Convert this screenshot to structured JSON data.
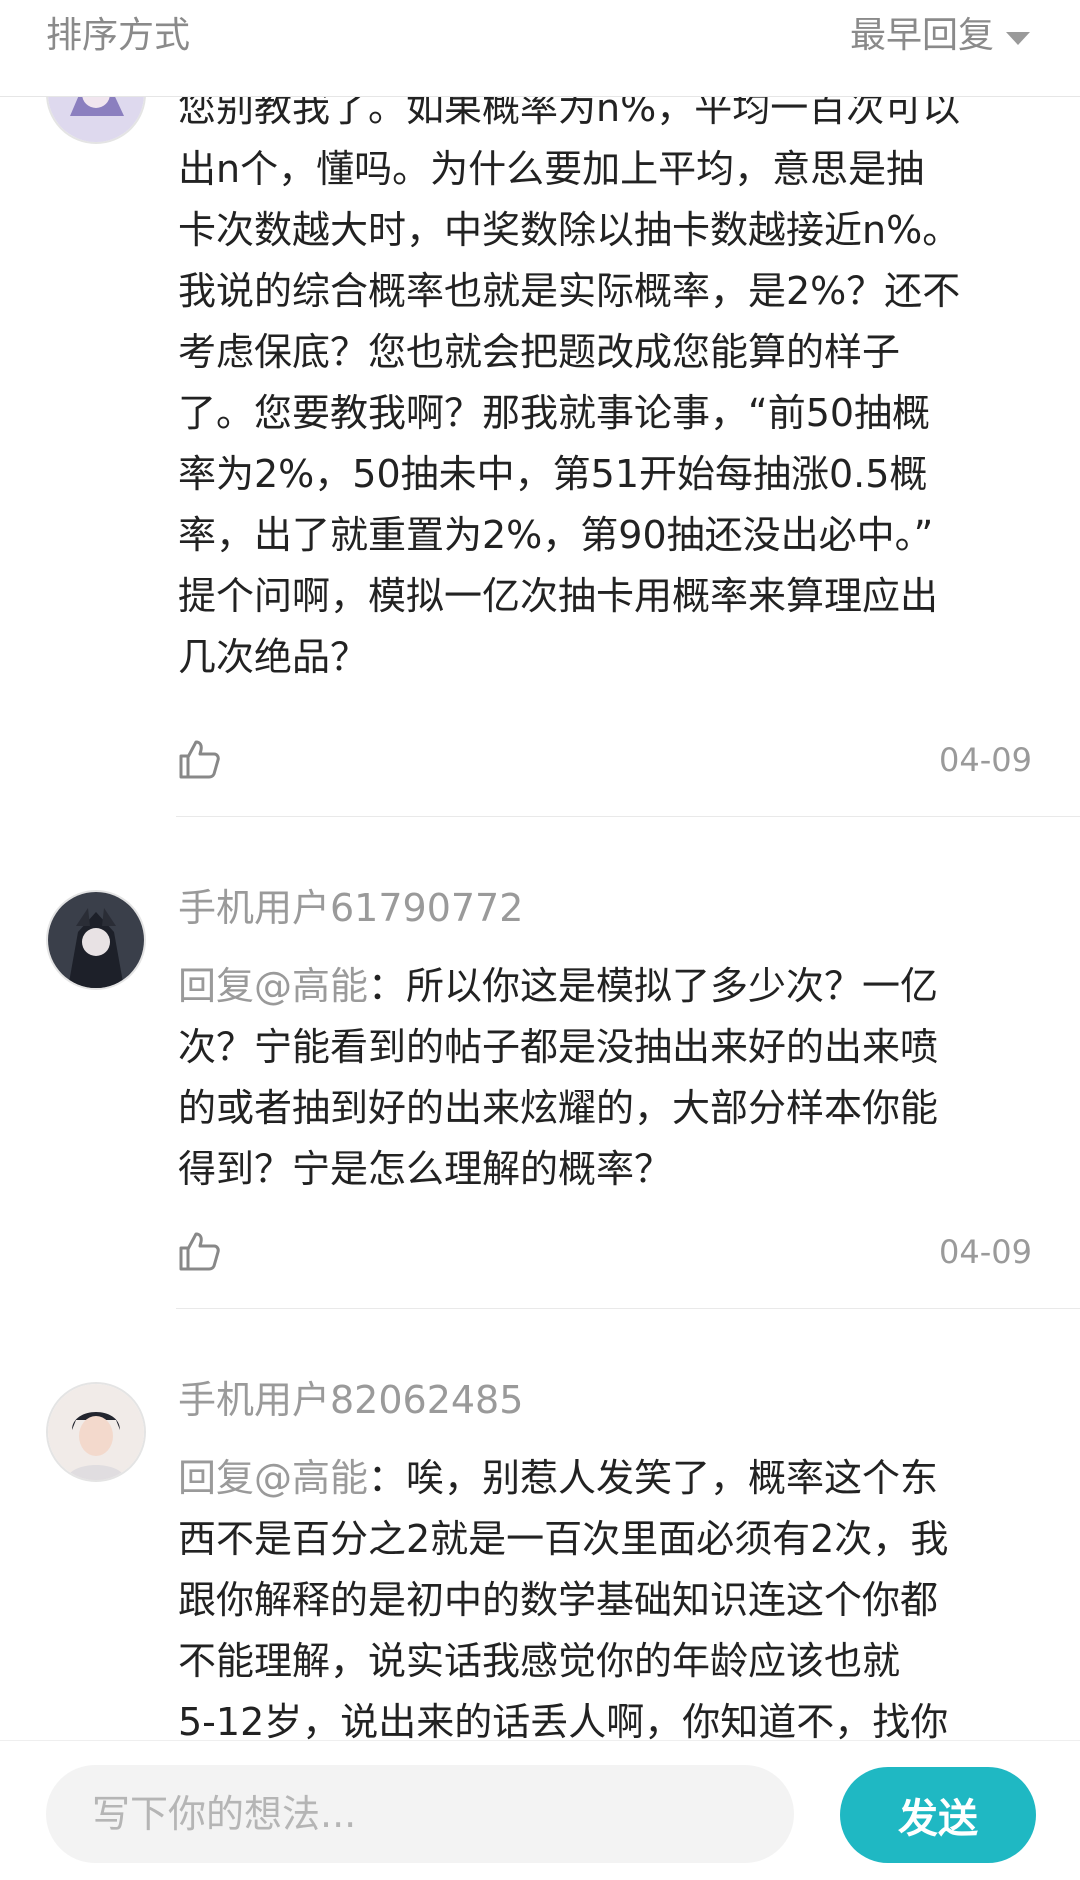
{
  "header": {
    "sort_label": "排序方式",
    "sort_value": "最早回复"
  },
  "comments": [
    {
      "username": "",
      "reply_prefix": "",
      "text": "您别教我了。如果概率为n%，平均一百次可以\n出n个，懂吗。为什么要加上平均，意思是抽\n卡次数越大时，中奖数除以抽卡数越接近n%。\n我说的综合概率也就是实际概率，是2%？还不\n考虑保底？您也就会把题改成您能算的样子\n了。您要教我啊？那我就事论事，“前50抽概\n率为2%，50抽未中，第51开始每抽涨0.5概\n率，出了就重置为2%，第90抽还没出必中。”\n提个问啊，模拟一亿次抽卡用概率来算理应出\n几次绝品？",
      "date": "04-09"
    },
    {
      "username": "手机用户61790772",
      "reply_prefix": "回复@高能",
      "text": "：所以你这是模拟了多少次？一亿\n次？宁能看到的帖子都是没抽出来好的出来喷\n的或者抽到好的出来炫耀的，大部分样本你能\n得到？宁是怎么理解的概率？",
      "date": "04-09"
    },
    {
      "username": "手机用户82062485",
      "reply_prefix": "回复@高能",
      "text": "：唉，别惹人发笑了，概率这个东\n西不是百分之2就是一百次里面必须有2次，我\n跟你解释的是初中的数学基础知识连这个你都\n不能理解，说实话我感觉你的年龄应该也就\n5-12岁，说出来的话丢人啊，你知道不，找你",
      "date": ""
    }
  ],
  "composer": {
    "placeholder": "写下你的想法...",
    "send_label": "发送"
  },
  "colors": {
    "accent": "#1fb8c3",
    "muted_text": "#9a9a9a",
    "body_text": "#222222"
  },
  "icons": [
    "caret-down-icon",
    "thumbs-up-icon"
  ]
}
